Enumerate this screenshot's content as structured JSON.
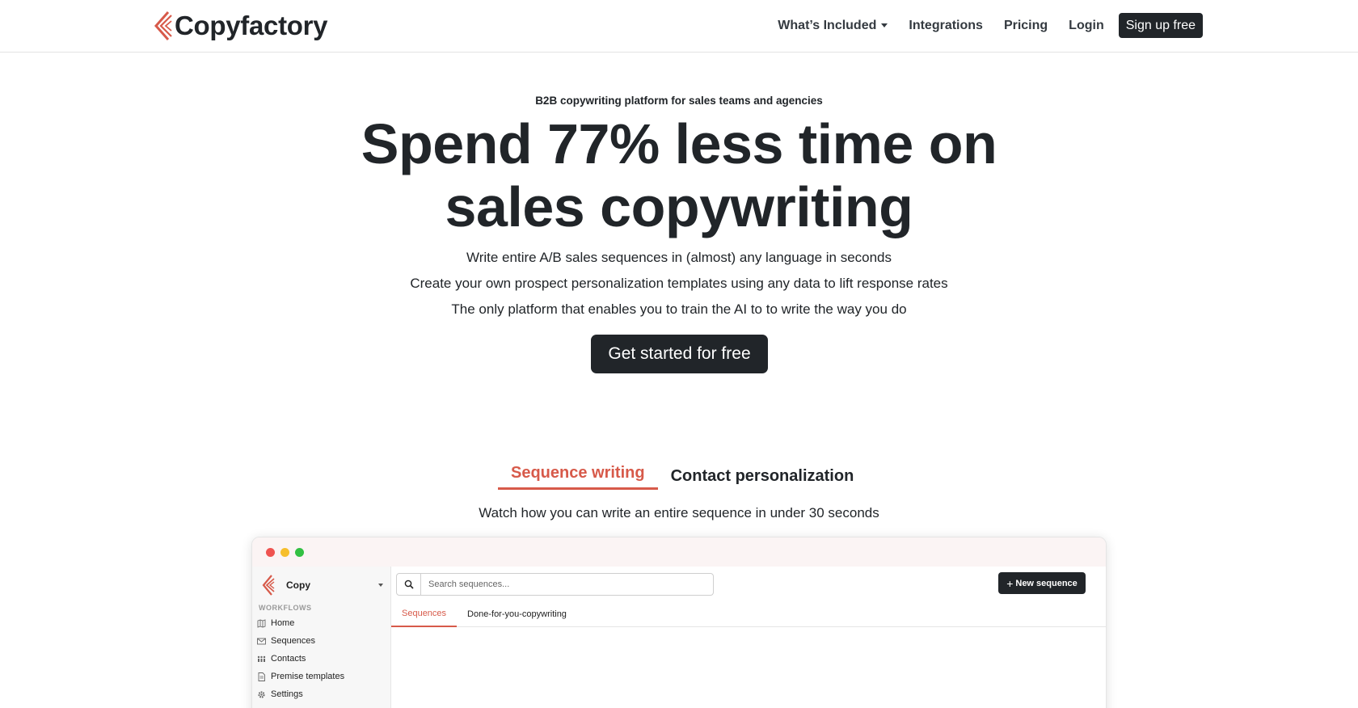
{
  "brand": {
    "name": "Copyfactory",
    "accent": "#d75a4a",
    "dark": "#212529"
  },
  "nav": {
    "items": [
      {
        "label": "What’s Included",
        "dropdown": true
      },
      {
        "label": "Integrations"
      },
      {
        "label": "Pricing"
      },
      {
        "label": "Login"
      }
    ],
    "signup_label": "Sign up free"
  },
  "hero": {
    "eyebrow": "B2B copywriting platform for sales teams and agencies",
    "headline_line1": "Spend 77% less time on",
    "headline_line2": "sales copywriting",
    "sub1": "Write entire A/B sales sequences in (almost) any language in seconds",
    "sub2": "Create your own prospect personalization templates using any data to lift response rates",
    "sub3": "The only platform that enables you to train the AI to to write the way you do",
    "cta_label": "Get started for free"
  },
  "features": {
    "tabs": [
      {
        "label": "Sequence writing",
        "active": true
      },
      {
        "label": "Contact personalization",
        "active": false
      }
    ],
    "caption": "Watch how you can write an entire sequence in under 30 seconds"
  },
  "app": {
    "workspace": "Copy",
    "sidebar_heading": "WORKFLOWS",
    "sidebar_items": [
      {
        "label": "Home",
        "icon": "map-icon"
      },
      {
        "label": "Sequences",
        "icon": "mail-icon"
      },
      {
        "label": "Contacts",
        "icon": "people-icon"
      },
      {
        "label": "Premise templates",
        "icon": "document-icon"
      },
      {
        "label": "Settings",
        "icon": "gear-icon"
      }
    ],
    "search_placeholder": "Search sequences...",
    "new_button": "New sequence",
    "tabs": [
      {
        "label": "Sequences",
        "active": true
      },
      {
        "label": "Done-for-you-copywriting",
        "active": false
      }
    ]
  }
}
